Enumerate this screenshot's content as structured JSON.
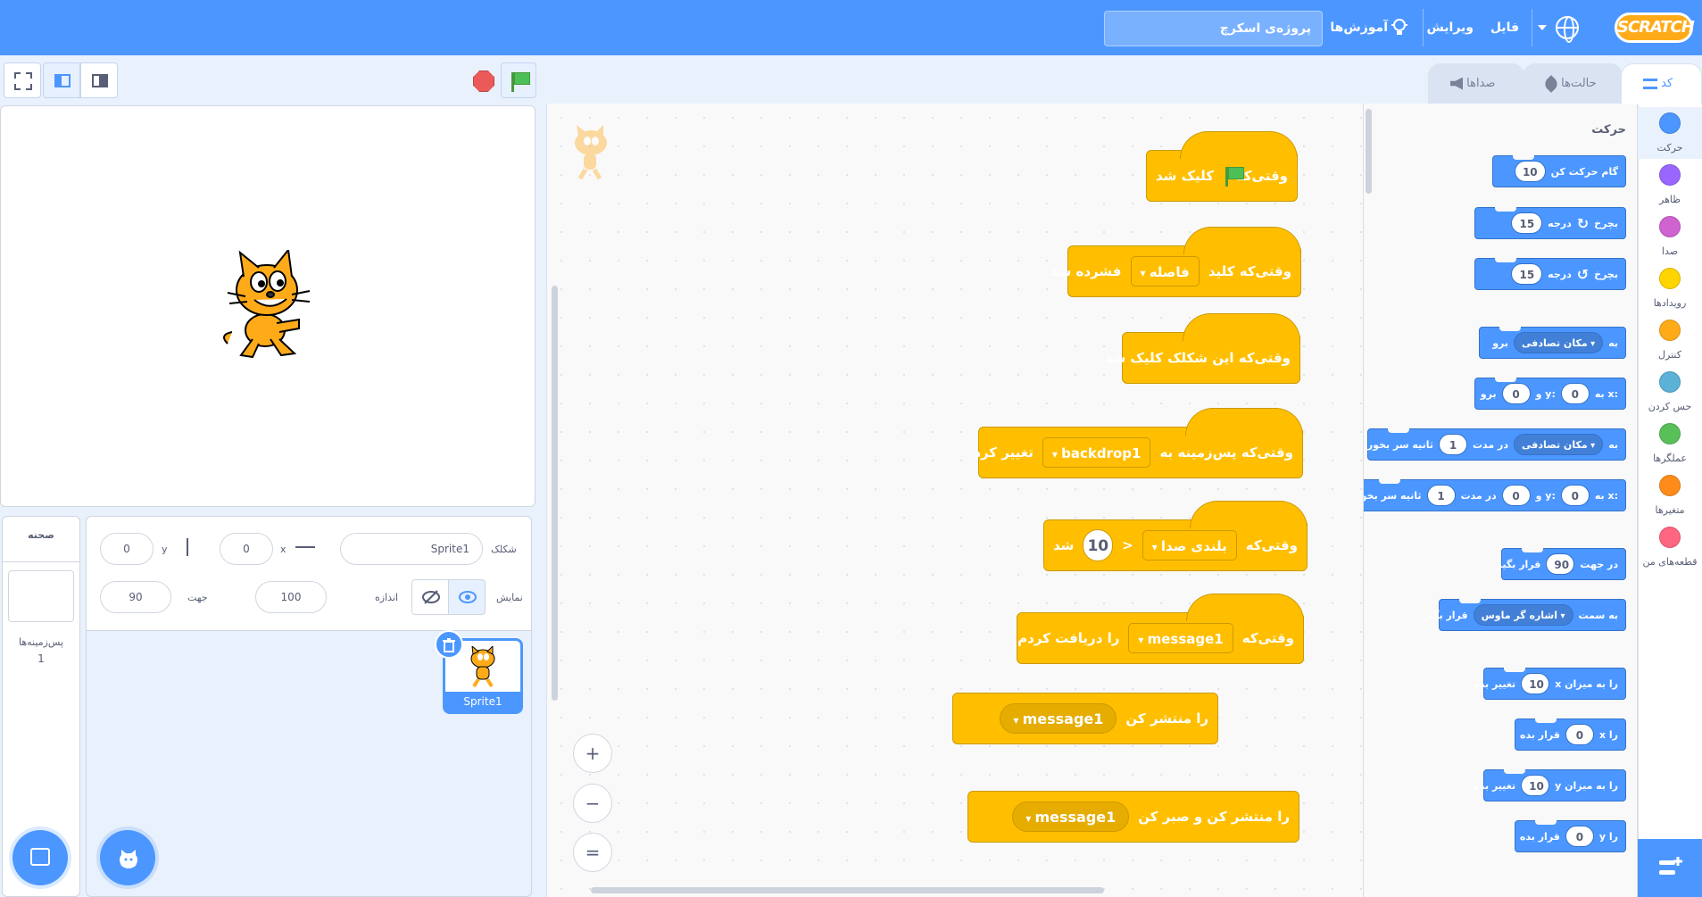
{
  "menubar": {
    "logo": "SCRATCH",
    "file": "فایل",
    "edit": "ویرایش",
    "tutorials": "آموزش‌ها",
    "project_title": "پروژه‌ی اسکرچ"
  },
  "tabs": {
    "code": "کد",
    "costumes": "حالت‌ها",
    "sounds": "صداها"
  },
  "categories": [
    {
      "label": "حرکت",
      "color": "#4c97ff"
    },
    {
      "label": "ظاهر",
      "color": "#9966ff"
    },
    {
      "label": "صدا",
      "color": "#cf63cf"
    },
    {
      "label": "رویدادها",
      "color": "#ffd500"
    },
    {
      "label": "کنترل",
      "color": "#ffab19"
    },
    {
      "label": "حس کردن",
      "color": "#5cb1d6"
    },
    {
      "label": "عملگرها",
      "color": "#59c059"
    },
    {
      "label": "متغیرها",
      "color": "#ff8c1a"
    },
    {
      "label": "قطعه‌های من",
      "color": "#ff6680"
    }
  ],
  "flyout": {
    "section_title": "حرکت",
    "blocks": [
      {
        "parts": [
          "10",
          "گام حرکت کن"
        ]
      },
      {
        "parts": [
          "15",
          "درجه",
          "↻",
          "بچرخ"
        ]
      },
      {
        "parts": [
          "15",
          "درجه",
          "↺",
          "بچرخ"
        ]
      },
      {
        "parts": [
          "به",
          "مکان تصادفی",
          "برو"
        ]
      },
      {
        "parts": [
          "به x:",
          "0",
          "و y:",
          "0",
          "برو"
        ]
      },
      {
        "parts": [
          "به",
          "مکان تصادفی",
          "در مدت",
          "1",
          "ثانیه سر بخور"
        ]
      },
      {
        "parts": [
          "به x:",
          "0",
          "و y:",
          "0",
          "در مدت",
          "1",
          "ثانیه سر بخور"
        ]
      },
      {
        "parts": [
          "در جهت",
          "90",
          "قرار بگیر"
        ]
      },
      {
        "parts": [
          "به سمت",
          "اشاره گر ماوس",
          "قرار بگیر"
        ]
      },
      {
        "parts": [
          "x را به میزان",
          "10",
          "تغییر بده"
        ]
      },
      {
        "parts": [
          "x را",
          "0",
          "قرار بده"
        ]
      },
      {
        "parts": [
          "y را به میزان",
          "10",
          "تغییر بده"
        ]
      },
      {
        "parts": [
          "y را",
          "0",
          "قرار بده"
        ]
      }
    ]
  },
  "code": {
    "b1": {
      "a": "وقتی‌که",
      "b": "کلیک شد"
    },
    "b2": {
      "a": "وقتی‌که کلید",
      "key": "فاصله",
      "b": "فشرده شد"
    },
    "b3": {
      "a": "وقتی‌که این شکلک کلیک شد"
    },
    "b4": {
      "a": "وقتی‌که پس‌زمینه به",
      "backdrop": "backdrop1",
      "b": "تغییر کرد"
    },
    "b5": {
      "a": "وقتی‌که",
      "sensor": "بلندی صدا",
      "op": ">",
      "num": "10",
      "b": "شد"
    },
    "b6": {
      "a": "وقتی‌که",
      "msg": "message1",
      "b": "را دریافت کردم"
    },
    "b7": {
      "msg": "message1",
      "b": "را منتشر کن"
    },
    "b8": {
      "msg": "message1",
      "b": "را منتشر کن و صبر کن"
    }
  },
  "zoom": {
    "in": "+",
    "out": "−",
    "reset": "="
  },
  "sprite_info": {
    "sprite_label": "شکلک",
    "sprite_name": "Sprite1",
    "x_label": "x",
    "x_value": "0",
    "y_label": "y",
    "y_value": "0",
    "show_label": "نمایش",
    "size_label": "اندازه",
    "size_value": "100",
    "direction_label": "جهت",
    "direction_value": "90"
  },
  "sprite_card": {
    "name": "Sprite1"
  },
  "stage_pane": {
    "title": "صحنه",
    "backdrops_label": "پس‌زمینه‌ها",
    "backdrops_count": "1"
  }
}
